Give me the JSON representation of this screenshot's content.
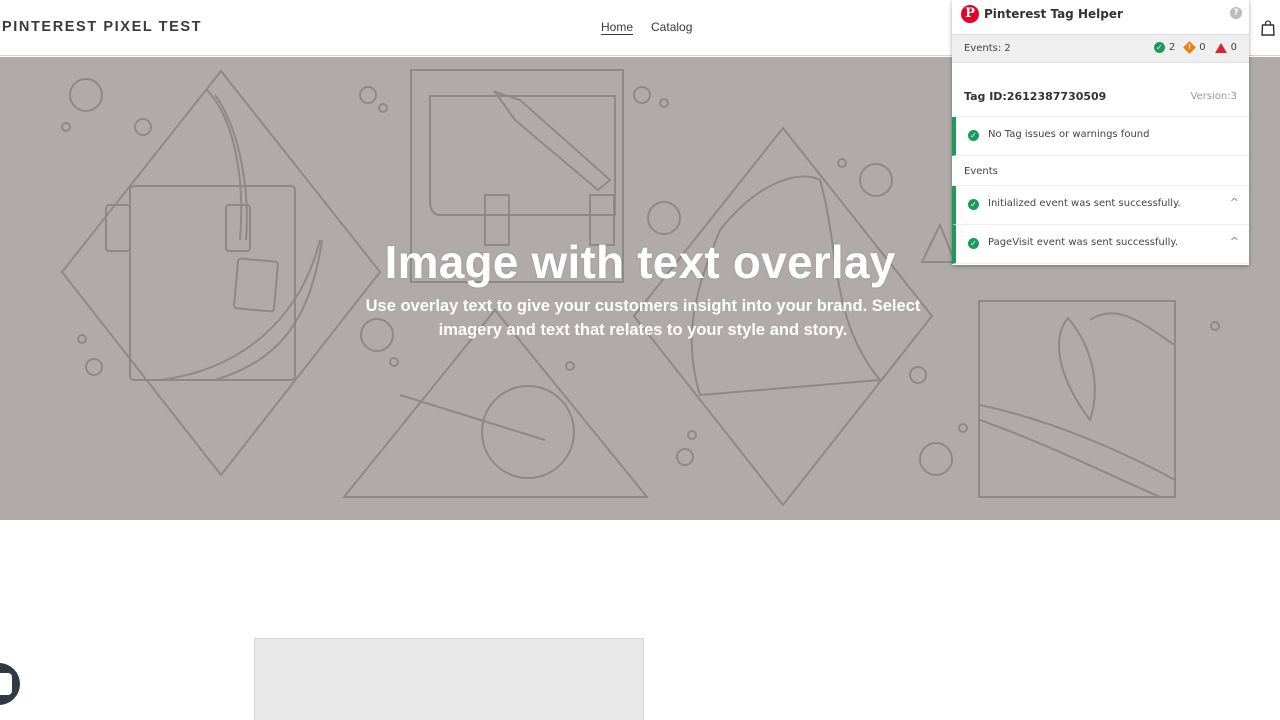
{
  "header": {
    "logo": "PINTEREST PIXEL TEST",
    "nav": [
      {
        "label": "Home",
        "active": true
      },
      {
        "label": "Catalog",
        "active": false
      }
    ],
    "cart_icon": "shopping-bag-icon"
  },
  "hero": {
    "title": "Image with text overlay",
    "subtitle": "Use overlay text to give your customers insight into your brand. Select imagery and text that relates to your style and story.",
    "background_color": "#b0aaaa",
    "line_color": "#8f8888"
  },
  "helper": {
    "title": "Pinterest Tag Helper",
    "logo_letter": "P",
    "help_icon": "?",
    "events_label": "Events: 2",
    "counts": {
      "success": "2",
      "warning": "0",
      "error": "0"
    },
    "tag_id": "Tag ID:2612387730509",
    "version": "Version:3",
    "status_message": "No Tag issues or warnings found",
    "events_heading": "Events",
    "events": [
      {
        "text": "Initialized event was sent successfully."
      },
      {
        "text": "PageVisit event was sent successfully."
      }
    ],
    "colors": {
      "brand": "#e60023",
      "success": "#1a9b5a",
      "warning": "#e8820c",
      "error": "#d8262f"
    }
  }
}
